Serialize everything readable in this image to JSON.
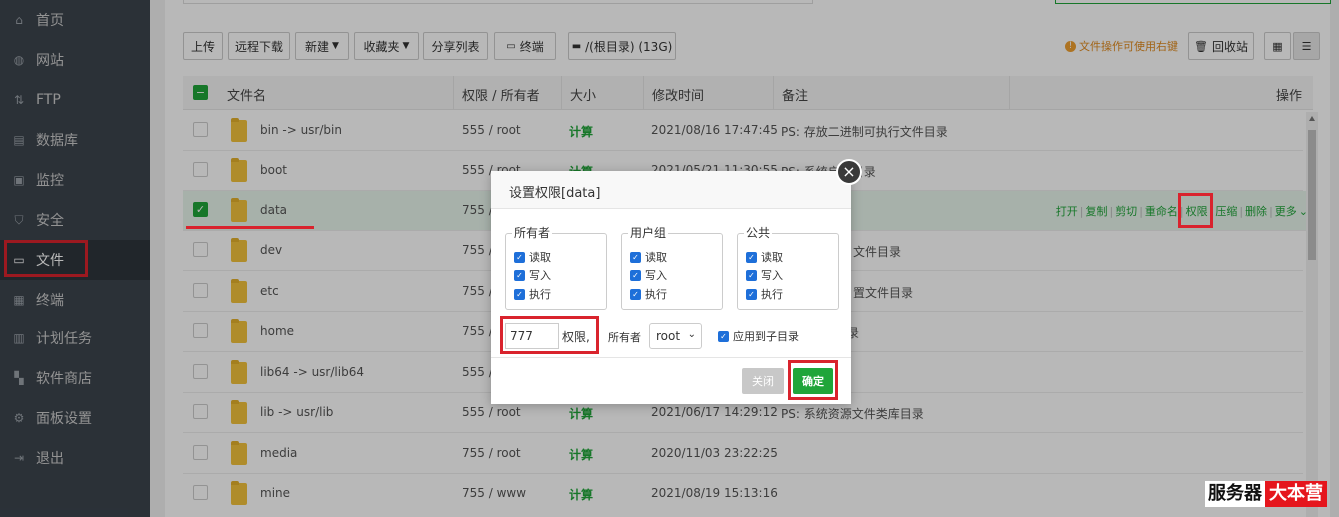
{
  "sidebar": {
    "items": [
      {
        "label": "首页",
        "icon": "home-icon"
      },
      {
        "label": "网站",
        "icon": "globe-icon"
      },
      {
        "label": "FTP",
        "icon": "ftp-icon"
      },
      {
        "label": "数据库",
        "icon": "database-icon"
      },
      {
        "label": "监控",
        "icon": "monitor-icon"
      },
      {
        "label": "安全",
        "icon": "shield-icon"
      },
      {
        "label": "文件",
        "icon": "folder-icon"
      },
      {
        "label": "终端",
        "icon": "terminal-icon"
      },
      {
        "label": "计划任务",
        "icon": "calendar-icon"
      },
      {
        "label": "软件商店",
        "icon": "grid-icon"
      },
      {
        "label": "面板设置",
        "icon": "gear-icon"
      },
      {
        "label": "退出",
        "icon": "logout-icon"
      }
    ]
  },
  "toolbar": {
    "upload": "上传",
    "remote_download": "远程下载",
    "new": "新建",
    "favorites": "收藏夹",
    "share_list": "分享列表",
    "terminal": "终端",
    "disk": "/(根目录) (13G)",
    "tip": "文件操作可使用右键",
    "recycle": "回收站"
  },
  "table": {
    "headers": {
      "name": "文件名",
      "perm": "权限 / 所有者",
      "size": "大小",
      "mtime": "修改时间",
      "note": "备注",
      "ops": "操作"
    },
    "rows": [
      {
        "name": "bin -> usr/bin",
        "perm": "555 / root",
        "size": "计算",
        "mtime": "2021/08/16 17:47:45",
        "note": "PS: 存放二进制可执行文件目录"
      },
      {
        "name": "boot",
        "perm": "555 / root",
        "size": "计算",
        "mtime": "2021/05/21 11:30:55",
        "note": "PS: 系统启动目录"
      },
      {
        "name": "data",
        "perm": "755 / root",
        "size": "",
        "mtime": "",
        "note": ""
      },
      {
        "name": "dev",
        "perm": "755 / root",
        "size": "",
        "mtime": "",
        "note": "文件目录"
      },
      {
        "name": "etc",
        "perm": "755 / root",
        "size": "",
        "mtime": "",
        "note": "置文件目录"
      },
      {
        "name": "home",
        "perm": "755 / root",
        "size": "",
        "mtime": "",
        "note": "录"
      },
      {
        "name": "lib64 -> usr/lib64",
        "perm": "555 / root",
        "size": "",
        "mtime": "",
        "note": ""
      },
      {
        "name": "lib -> usr/lib",
        "perm": "555 / root",
        "size": "计算",
        "mtime": "2021/06/17 14:29:12",
        "note": "PS: 系统资源文件类库目录"
      },
      {
        "name": "media",
        "perm": "755 / root",
        "size": "计算",
        "mtime": "2020/11/03 23:22:25",
        "note": ""
      },
      {
        "name": "mine",
        "perm": "755 / www",
        "size": "计算",
        "mtime": "2021/08/19 15:13:16",
        "note": ""
      }
    ],
    "ops": {
      "open": "打开",
      "copy": "复制",
      "cut": "剪切",
      "rename": "重命名",
      "perm": "权限",
      "zip": "压缩",
      "delete": "删除",
      "more": "更多"
    }
  },
  "modal": {
    "title": "设置权限[data]",
    "groups": [
      {
        "label": "所有者",
        "options": [
          "读取",
          "写入",
          "执行"
        ]
      },
      {
        "label": "用户组",
        "options": [
          "读取",
          "写入",
          "执行"
        ]
      },
      {
        "label": "公共",
        "options": [
          "读取",
          "写入",
          "执行"
        ]
      }
    ],
    "perm_value": "777",
    "perm_label": "权限,",
    "owner_label": "所有者",
    "owner_value": "root",
    "apply_sub": "应用到子目录",
    "close_btn": "关闭",
    "ok_btn": "确定"
  },
  "brand": {
    "part1": "服务器",
    "part2": "大本营"
  },
  "colors": {
    "accent": "#20a53a",
    "highlight": "#d9232d",
    "sidebar": "#3c444d"
  }
}
